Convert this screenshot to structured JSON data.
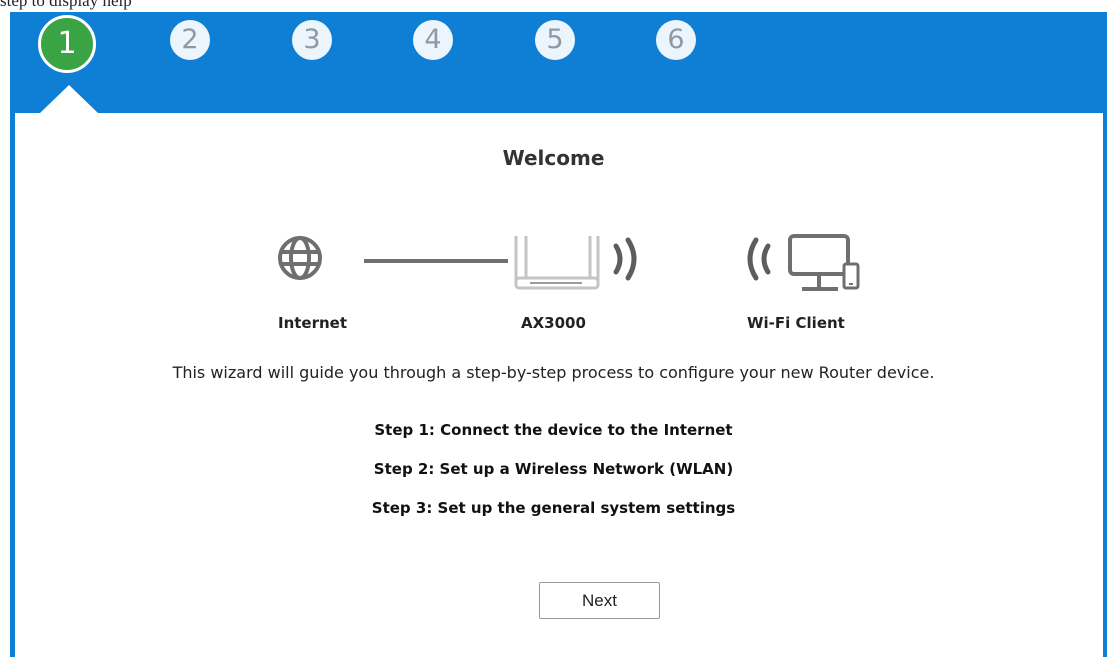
{
  "top_fragment": "step to display help",
  "wizard": {
    "steps": [
      {
        "number": "1",
        "active": true
      },
      {
        "number": "2",
        "active": false
      },
      {
        "number": "3",
        "active": false
      },
      {
        "number": "4",
        "active": false
      },
      {
        "number": "5",
        "active": false
      },
      {
        "number": "6",
        "active": false
      }
    ],
    "title": "Welcome",
    "diagram": {
      "internet_label": "Internet",
      "router_label": "AX3000",
      "client_label": "Wi-Fi Client",
      "icons": [
        "globe-icon",
        "router-icon",
        "wifi-signal-icon",
        "computer-phone-icon"
      ]
    },
    "description": "This wizard will guide you through a step-by-step process to configure your new Router device.",
    "step_lines": [
      "Step 1: Connect the device to the Internet",
      "Step 2: Set up a Wireless Network (WLAN)",
      "Step 3: Set up the general system settings"
    ],
    "next_label": "Next"
  },
  "colors": {
    "header_blue": "#0e7fd4",
    "active_step_green": "#3aa445",
    "icon_gray": "#6f6f6f",
    "router_gray": "#c4c4c4"
  }
}
